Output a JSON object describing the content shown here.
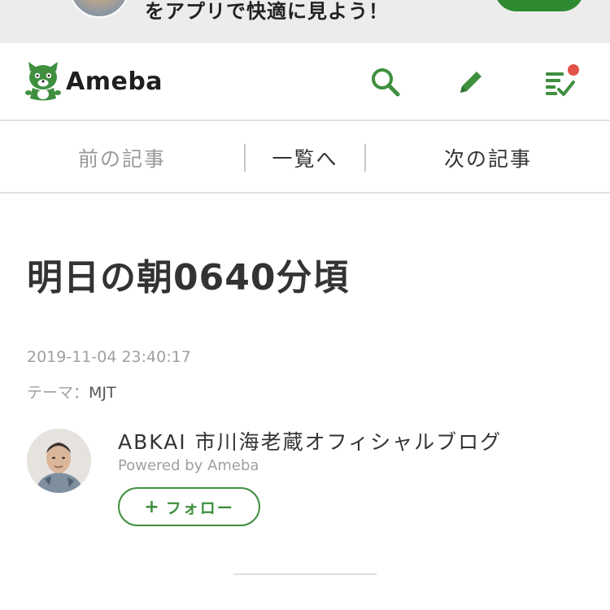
{
  "banner": {
    "text": "をアプリで快適に見よう！"
  },
  "header": {
    "logo_text": "Ameba",
    "search_label": "search",
    "write_label": "write",
    "reading_list_label": "reading list"
  },
  "article_nav": {
    "prev": "前の記事",
    "list": "一覧へ",
    "next": "次の記事"
  },
  "article": {
    "title": "明日の朝0640分頃",
    "date": "2019-11-04 23:40:17",
    "theme_label": "テーマ：",
    "theme_value": "MJT"
  },
  "author": {
    "blog_name": "ABKAI 市川海老蔵オフィシャルブログ",
    "powered_by": "Powered by Ameba",
    "follow_plus": "+",
    "follow_label": "フォロー"
  },
  "colors": {
    "brand_green": "#3f8f3f",
    "notify_red": "#e2524a",
    "text_dark": "#333333",
    "text_muted": "#a0a0a0"
  },
  "icons": [
    "ameba-logo-icon",
    "search-icon",
    "pencil-icon",
    "reading-list-icon",
    "notification-dot"
  ]
}
